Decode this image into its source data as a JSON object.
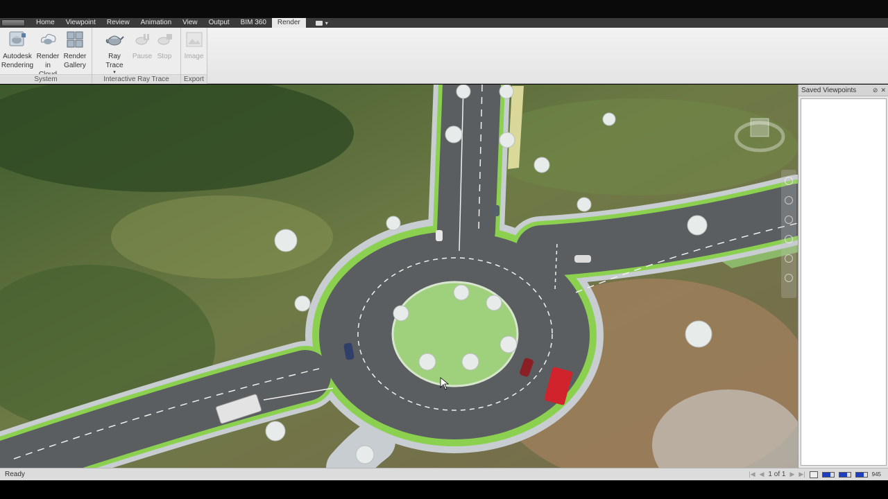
{
  "menu": {
    "tabs": [
      {
        "label": "Home"
      },
      {
        "label": "Viewpoint"
      },
      {
        "label": "Review"
      },
      {
        "label": "Animation"
      },
      {
        "label": "View"
      },
      {
        "label": "Output"
      },
      {
        "label": "BIM 360"
      },
      {
        "label": "Render"
      }
    ],
    "active_tab": "Render"
  },
  "ribbon": {
    "system": {
      "title": "System",
      "autodesk_rendering": "Autodesk\nRendering",
      "render_in_cloud": "Render\nin Cloud",
      "render_gallery": "Render\nGallery"
    },
    "interactive": {
      "title": "Interactive Ray Trace",
      "ray_trace": "Ray Trace",
      "pause": "Pause",
      "stop": "Stop"
    },
    "export": {
      "title": "Export",
      "image": "Image"
    }
  },
  "saved_viewpoints": {
    "title": "Saved Viewpoints"
  },
  "status": {
    "ready": "Ready",
    "page": "1 of 1",
    "memory": "945"
  },
  "colors": {
    "accent_blue": "#1d3fbf",
    "road": "#5a5e60",
    "grass_island": "#9fd07c",
    "curb_green": "#8bd14f"
  }
}
